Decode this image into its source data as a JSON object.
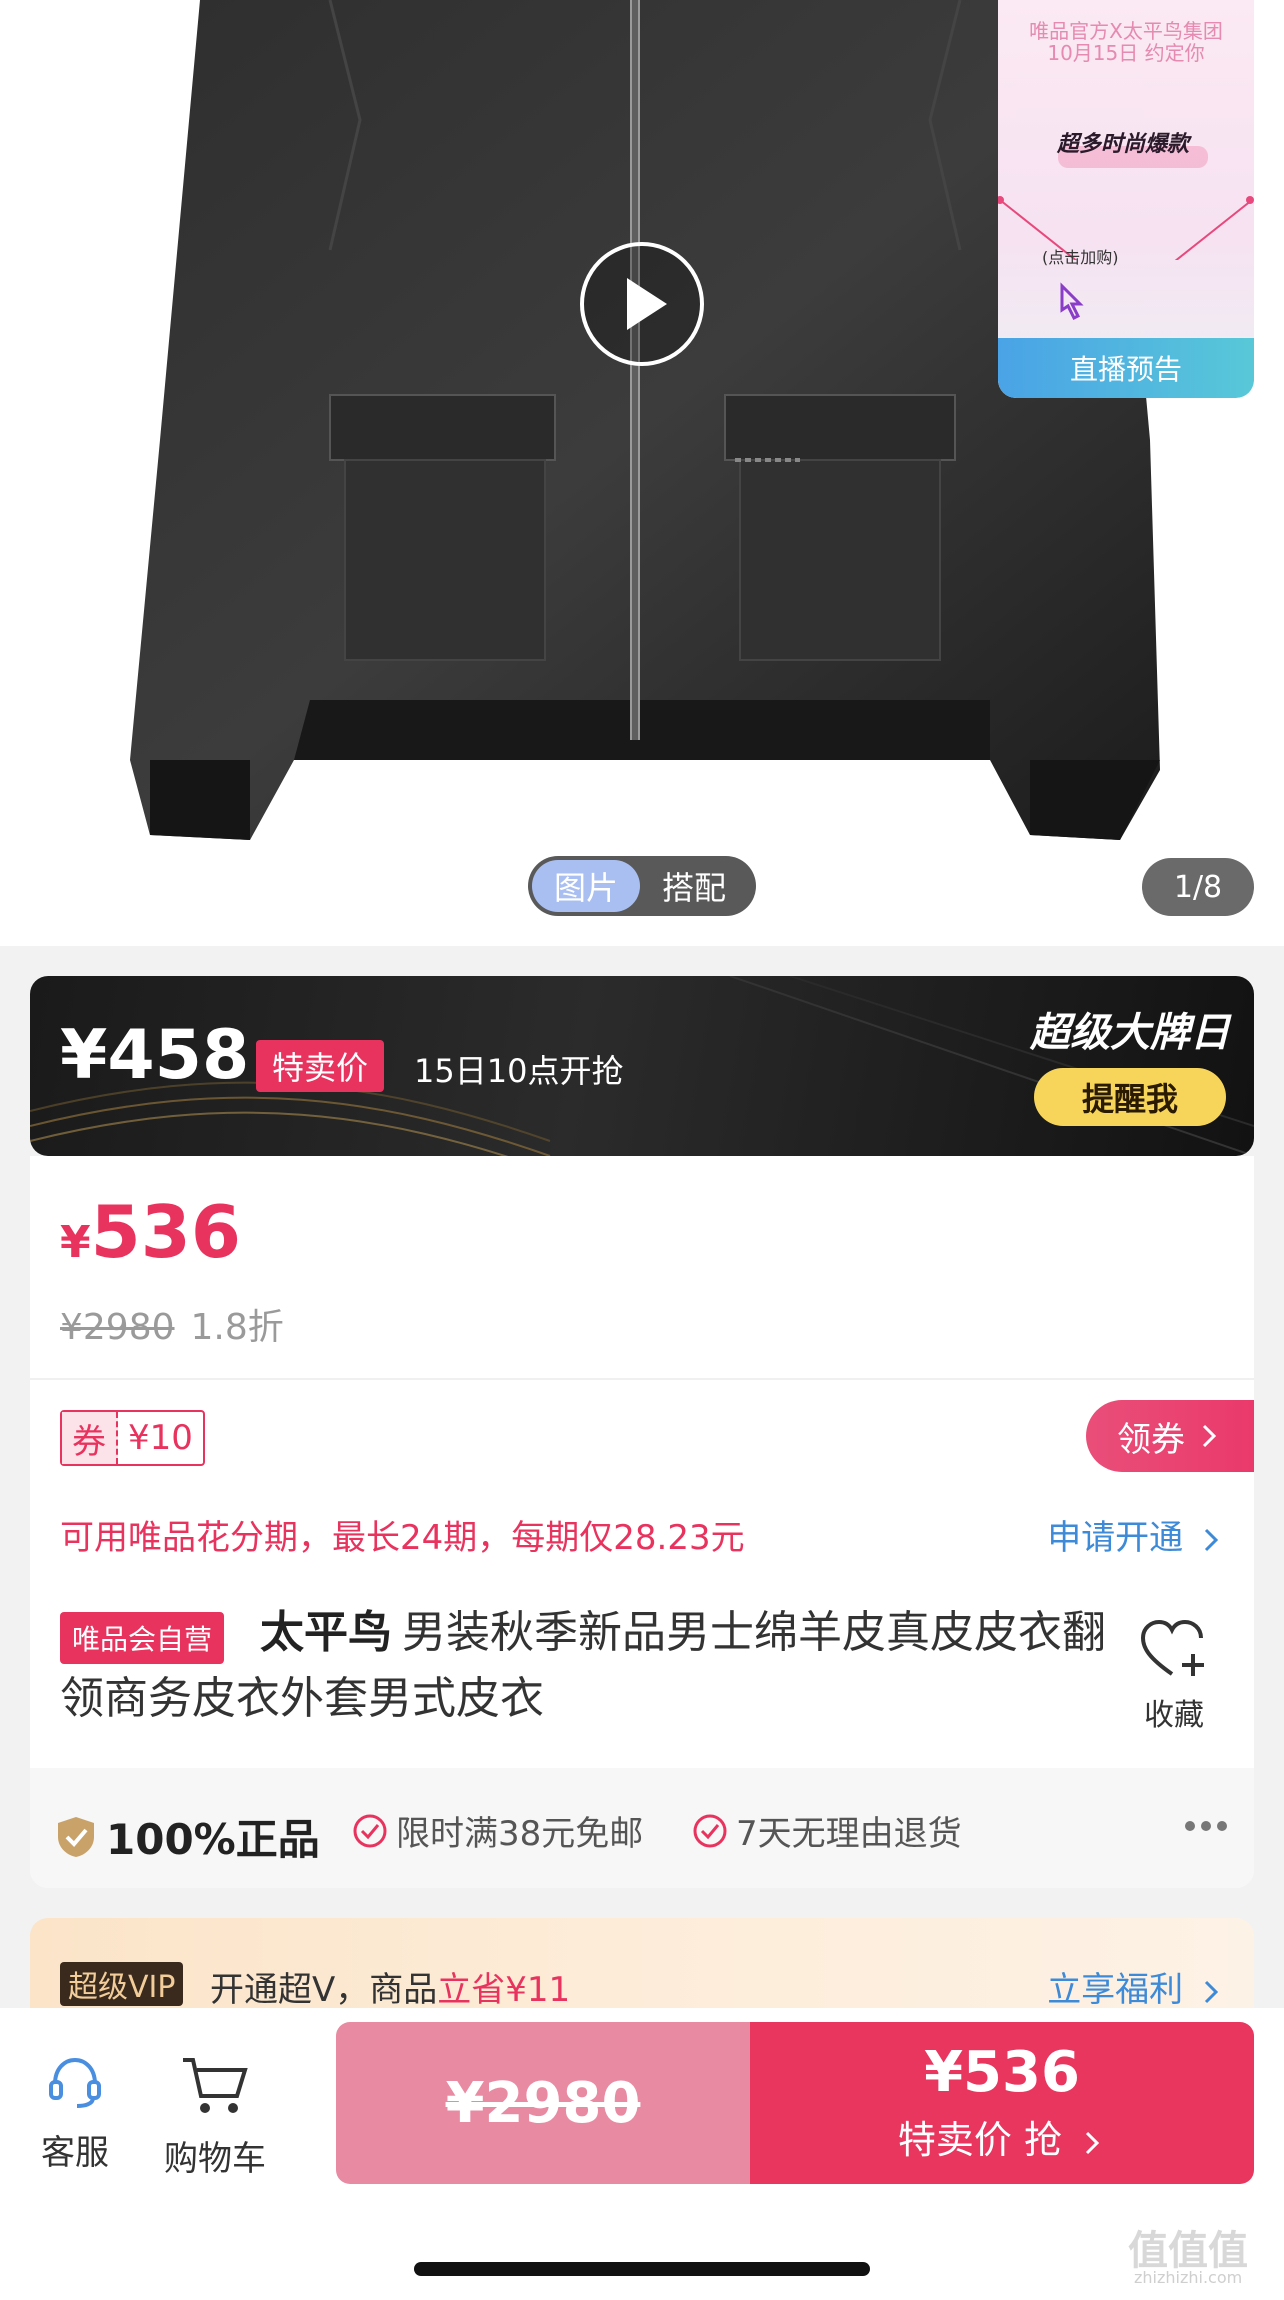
{
  "live_card": {
    "line1": "唯品官方X太平鸟集团",
    "line2": "10月15日 约定你",
    "hot": "超多时尚爆款",
    "tap_hint": "(点击加购)",
    "button": "直播预告"
  },
  "media": {
    "tabs": [
      "图片",
      "搭配"
    ],
    "active_tab": "图片",
    "pager": "1/8"
  },
  "promo": {
    "price": "¥458",
    "badge": "特卖价",
    "start_time": "15日10点开抢",
    "brand_day": "超级大牌日",
    "remind_button": "提醒我"
  },
  "price": {
    "symbol": "¥",
    "current": "536",
    "original": "¥2980",
    "discount": "1.8折"
  },
  "coupon": {
    "label": "券",
    "value": "¥10",
    "get_button": "领券"
  },
  "installment": {
    "text": "可用唯品花分期，最长24期，每期仅28.23元",
    "apply": "申请开通"
  },
  "product": {
    "self_badge": "唯品会自营",
    "brand": "太平鸟",
    "title": "男装秋季新品男士绵羊皮真皮皮衣翻领商务皮衣外套男式皮衣",
    "favorite_label": "收藏"
  },
  "guarantee": {
    "authentic": "100%正品",
    "free_shipping": "限时满38元免邮",
    "returns": "7天无理由退货"
  },
  "vip": {
    "tag": "超级VIP",
    "text": "开通超V，商品",
    "highlight": "立省¥11",
    "benefit": "立享福利"
  },
  "bottom_bar": {
    "service": "客服",
    "cart": "购物车",
    "original_price": "¥2980",
    "buy_price": "¥536",
    "buy_label": "特卖价 抢"
  },
  "watermark": {
    "logo": "值值值",
    "site": "zhizhizhi.com"
  },
  "colors": {
    "accent": "#e8335e",
    "link": "#3d8ad8",
    "remind": "#f7d55b"
  }
}
